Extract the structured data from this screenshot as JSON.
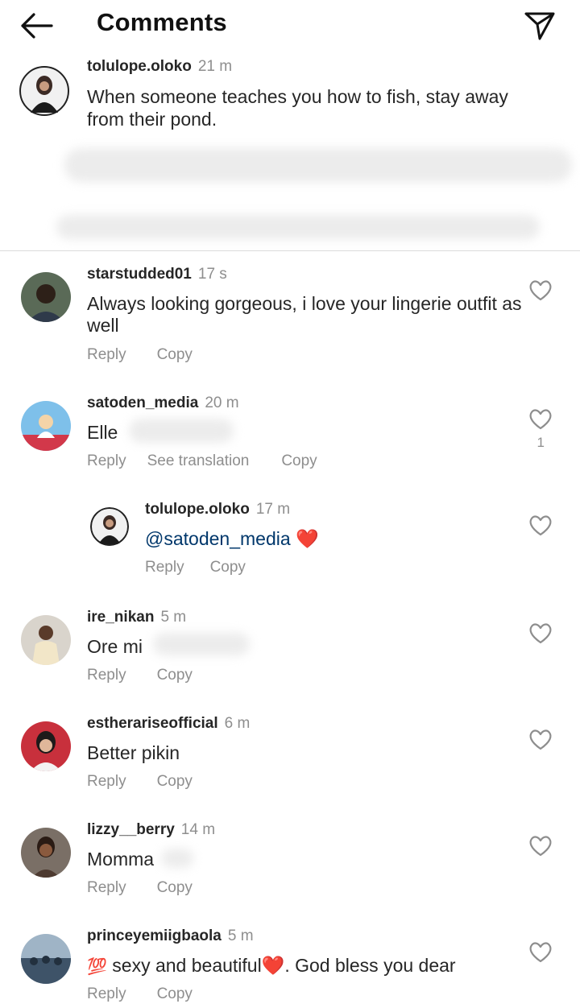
{
  "header": {
    "title": "Comments",
    "back_icon": "arrow-left-icon",
    "send_icon": "paper-plane-icon"
  },
  "caption": {
    "username": "tolulope.oloko",
    "time": "21 m",
    "text": "When someone teaches you how to fish, stay away from their pond."
  },
  "comments": [
    {
      "username": "starstudded01",
      "time": "17 s",
      "text": "Always looking gorgeous, i love your lingerie outfit as well",
      "reply": "Reply",
      "copy": "Copy"
    },
    {
      "username": "satoden_media",
      "time": "20 m",
      "text": "Elle",
      "reply": "Reply",
      "translate": "See translation",
      "copy": "Copy",
      "likes": "1"
    },
    {
      "username": "tolulope.oloko",
      "time": "17 m",
      "mention": "@satoden_media",
      "emoji": "❤️",
      "reply": "Reply",
      "copy": "Copy"
    },
    {
      "username": "ire_nikan",
      "time": "5 m",
      "text": "Ore mi",
      "reply": "Reply",
      "copy": "Copy"
    },
    {
      "username": "estherariseofficial",
      "time": "6 m",
      "text": "Better pikin",
      "reply": "Reply",
      "copy": "Copy"
    },
    {
      "username": "lizzy__berry",
      "time": "14 m",
      "text": "Momma",
      "reply": "Reply",
      "copy": "Copy"
    },
    {
      "username": "princeyemiigbaola",
      "time": "5 m",
      "emoji_prefix": "💯",
      "text": " sexy and beautiful❤️. God bless you dear",
      "reply": "Reply",
      "copy": "Copy"
    }
  ],
  "colors": {
    "accent_heart": "#ed4956",
    "mention": "#00376b",
    "muted": "#8e8e8e"
  }
}
